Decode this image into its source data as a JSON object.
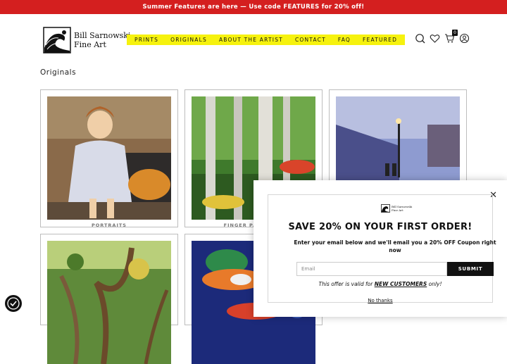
{
  "banner": {
    "text": "Summer Features are here — Use code FEATURES for 20% off!"
  },
  "logo": {
    "line1": "Bill Sarnowski",
    "line2": "Fine Art"
  },
  "nav": {
    "items": [
      "PRINTS",
      "ORIGINALS",
      "ABOUT THE ARTIST",
      "CONTACT",
      "FAQ",
      "FEATURED"
    ]
  },
  "header_icons": {
    "search": "search-icon",
    "wishlist": "heart-icon",
    "cart": "cart-icon",
    "account": "user-icon",
    "cart_count": "0"
  },
  "page": {
    "title": "Originals"
  },
  "gallery": {
    "cards": [
      {
        "label": "PORTRAITS"
      },
      {
        "label": "FINGER PAINTINGS"
      },
      {
        "label": ""
      },
      {
        "label": ""
      },
      {
        "label": ""
      }
    ]
  },
  "popup": {
    "logo_line1": "Bill Sarnowski",
    "logo_line2": "Fine Art",
    "title": "SAVE 20% ON YOUR FIRST ORDER!",
    "subtitle": "Enter your email below and we'll email you a 20% OFF Coupon right now",
    "email_placeholder": "Email",
    "submit_label": "SUBMIT",
    "offer_prefix": "This offer is valid for ",
    "offer_emphasis": "NEW CUSTOMERS",
    "offer_suffix": " only!",
    "no_thanks": "No thanks",
    "close": "✕"
  },
  "colors": {
    "banner": "#d41f1f",
    "nav_highlight": "#f6f20e",
    "submit": "#111111"
  }
}
